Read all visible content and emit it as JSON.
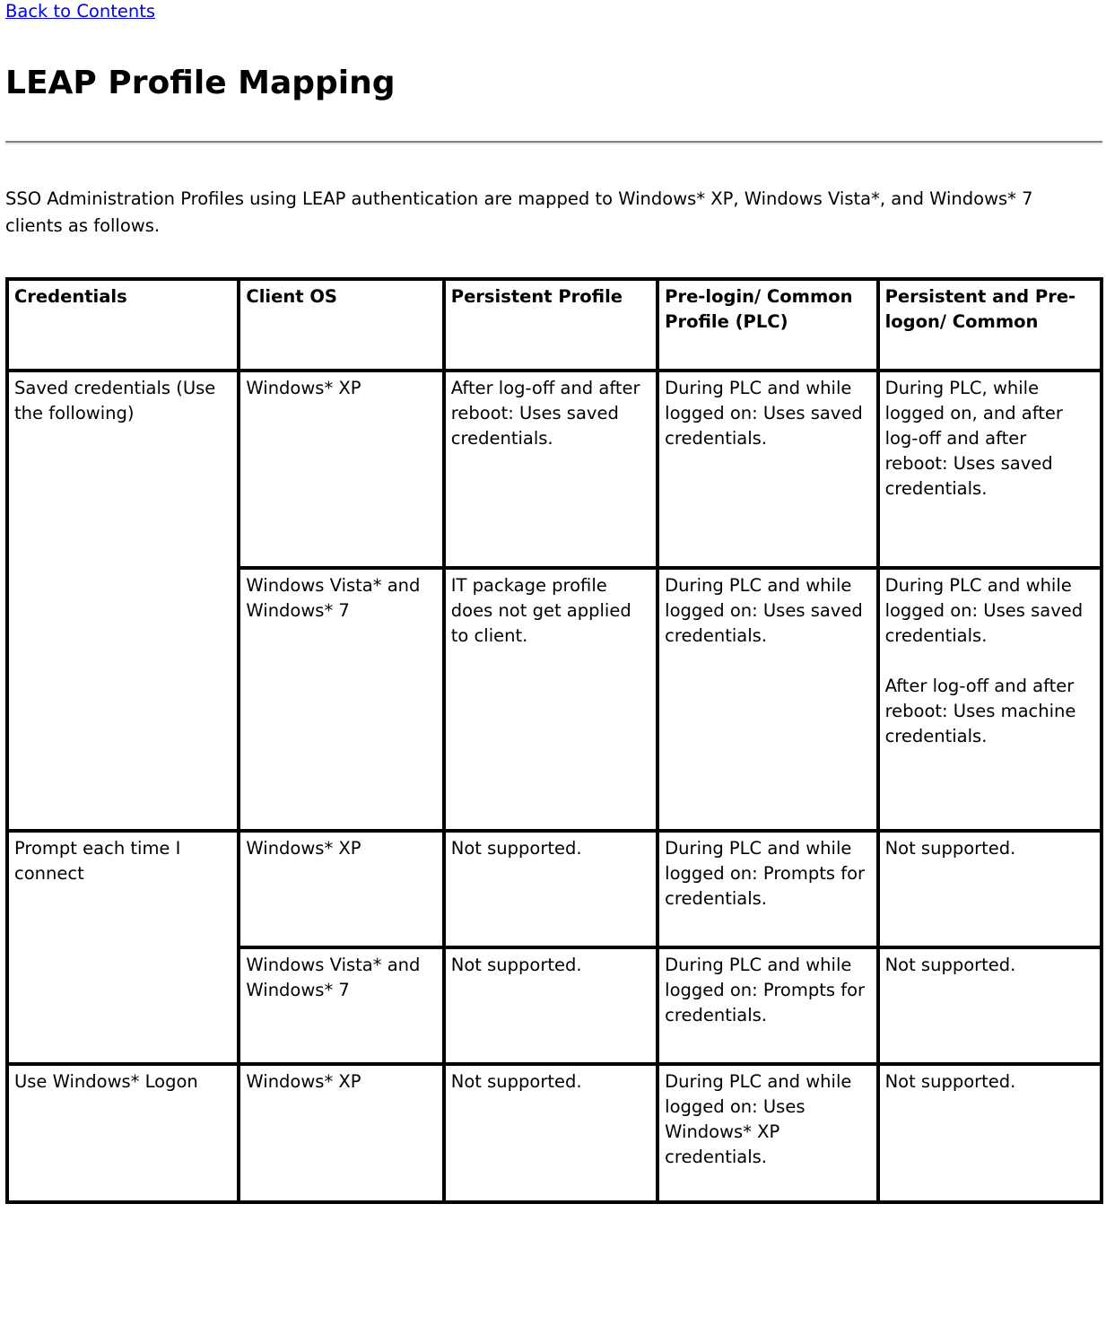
{
  "nav": {
    "back_link": "Back to Contents"
  },
  "header": {
    "title": "LEAP Profile Mapping"
  },
  "intro": {
    "paragraph": "SSO Administration Profiles using LEAP authentication are mapped to Windows* XP, Windows Vista*, and Windows* 7 clients as follows."
  },
  "table": {
    "columns": [
      "Credentials",
      "Client OS",
      "Persistent Profile",
      "Pre-login/ Common Profile (PLC)",
      "Persistent and Pre-logon/ Common"
    ],
    "rows": [
      {
        "credentials": "Saved credentials (Use the following)",
        "os": "Windows* XP",
        "persistent": "After log-off and after reboot: Uses saved credentials.",
        "plc": "During PLC and while logged on: Uses saved credentials.",
        "prelogon": "During PLC, while logged on, and after log-off and after reboot: Uses saved credentials.",
        "prelogon_2": ""
      },
      {
        "credentials": "",
        "os": "Windows Vista* and Windows* 7",
        "persistent": "IT package profile does not get applied to client.",
        "plc": "During PLC and while logged on: Uses saved credentials.",
        "prelogon": "During PLC and while logged on: Uses saved credentials.",
        "prelogon_2": "After log-off and after reboot: Uses machine credentials."
      },
      {
        "credentials": "Prompt each time I connect",
        "os": "Windows* XP",
        "persistent": "Not supported.",
        "plc": "During PLC and while logged on: Prompts for credentials.",
        "prelogon": "Not supported.",
        "prelogon_2": ""
      },
      {
        "credentials": "",
        "os": "Windows Vista* and Windows* 7",
        "persistent": "Not supported.",
        "plc": "During PLC and while logged on: Prompts for credentials.",
        "prelogon": "Not supported.",
        "prelogon_2": ""
      },
      {
        "credentials": "Use Windows* Logon",
        "os": "Windows* XP",
        "persistent": "Not supported.",
        "plc": "During PLC and while logged on: Uses Windows* XP credentials.",
        "prelogon": "Not supported.",
        "prelogon_2": ""
      }
    ]
  },
  "colors": {
    "link": "#0000EE",
    "rule": "#808080",
    "border": "#000000",
    "text": "#000000"
  }
}
